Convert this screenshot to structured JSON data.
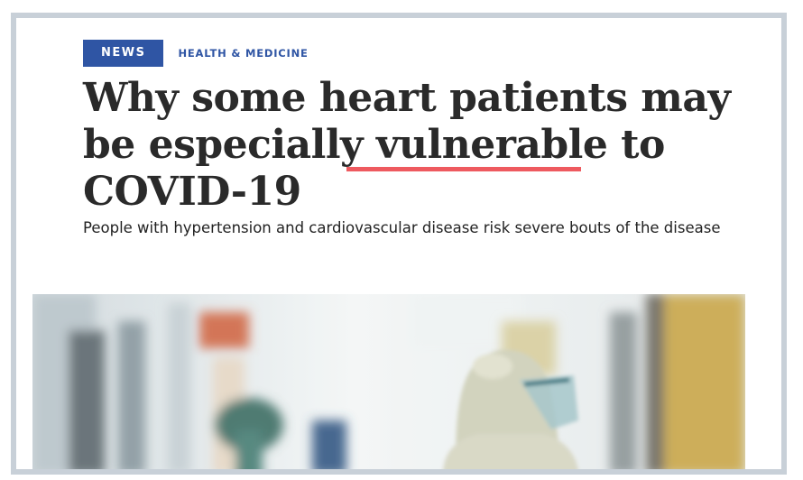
{
  "article": {
    "badge": "NEWS",
    "category": "HEALTH & MEDICINE",
    "headline_part1": "Why some heart patients may be especially ",
    "headline_emphasis": "vulnerable",
    "headline_part2": " to COVID-19",
    "dek": "People with hypertension and cardiovascular disease risk severe bouts of the disease"
  },
  "colors": {
    "badge_bg": "#2f55a4",
    "emphasis_underline": "#ee5a5f",
    "frame_border": "#c8d0d8"
  }
}
